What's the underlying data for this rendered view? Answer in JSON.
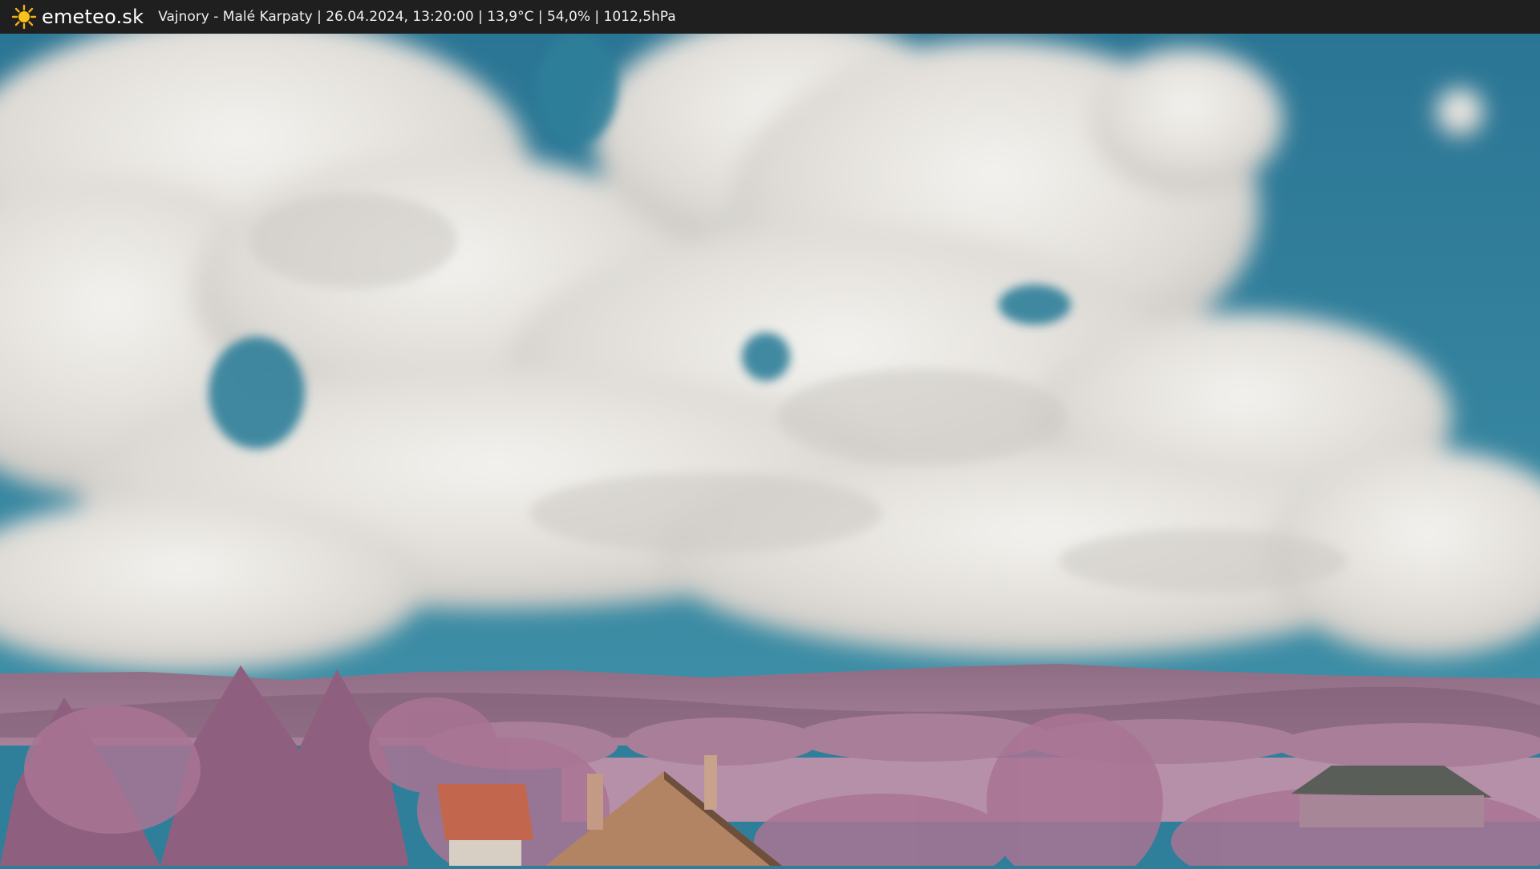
{
  "header": {
    "brand": "emeteo.sk",
    "brand_icon": "sun-icon",
    "caption": "Vajnory - Malé Karpaty | 26.04.2024, 13:20:00 | 13,9°C | 54,0% | 1012,5hPa"
  },
  "colors": {
    "bar_background": "#1f1f1f",
    "sky": "#2f7f9a",
    "clouds": "#e8e6e2",
    "foliage": "#b888a4",
    "sun": "#f5b018"
  }
}
